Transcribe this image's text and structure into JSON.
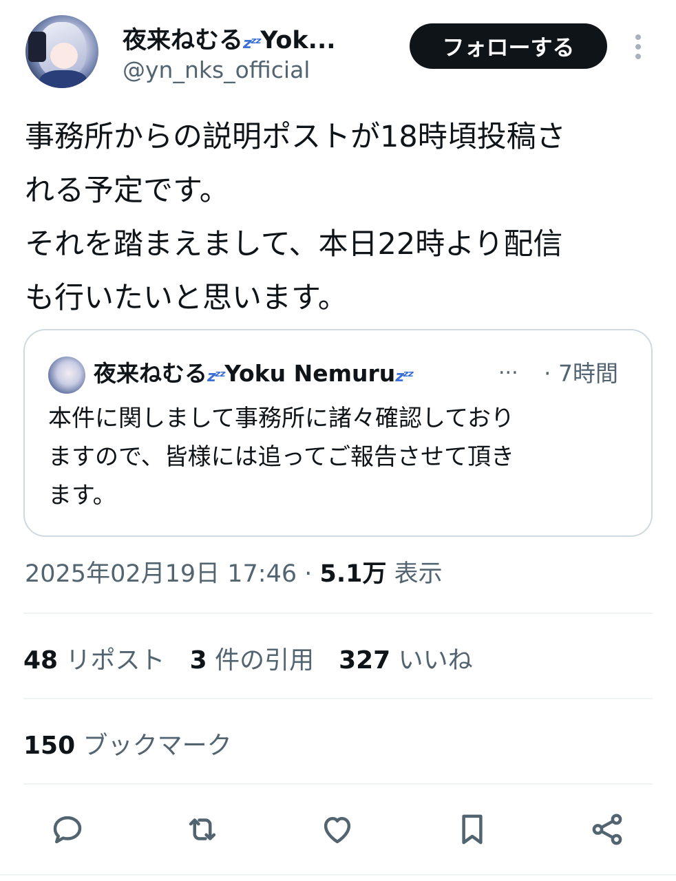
{
  "author": {
    "name": "夜来ねむる",
    "name_suffix": "Yok...",
    "handle": "@yn_nks_official"
  },
  "follow_button": "フォローする",
  "tweet": {
    "lines": [
      "事務所からの説明ポストが18時頃投稿さ",
      "れる予定です。",
      "それを踏まえまして、本日22時より配信",
      "も行いたいと思います。"
    ]
  },
  "quote": {
    "name": "夜来ねむる",
    "name_mid": "Yoku Nemuru",
    "ellipsis": "...",
    "time": "· 7時間",
    "lines": [
      "本件に関しまして事務所に諸々確認しており",
      "ますので、皆様には追ってご報告させて頂き",
      "ます。"
    ]
  },
  "meta": {
    "datetime": "2025年02月19日 17:46 · ",
    "views_count": "5.1万",
    "views_label": " 表示"
  },
  "stats": {
    "reposts_count": "48",
    "reposts_label": " リポスト",
    "quotes_count": "3",
    "quotes_label": " 件の引用",
    "likes_count": "327",
    "likes_label": " いいね"
  },
  "bookmarks": {
    "count": "150",
    "label": " ブックマーク"
  },
  "colors": {
    "text": "#0f1419",
    "secondary": "#536471",
    "border": "#cfd9de",
    "zzz": "#3a6fd8"
  },
  "icons": [
    "reply-icon",
    "repost-icon",
    "like-icon",
    "bookmark-icon",
    "share-icon"
  ]
}
